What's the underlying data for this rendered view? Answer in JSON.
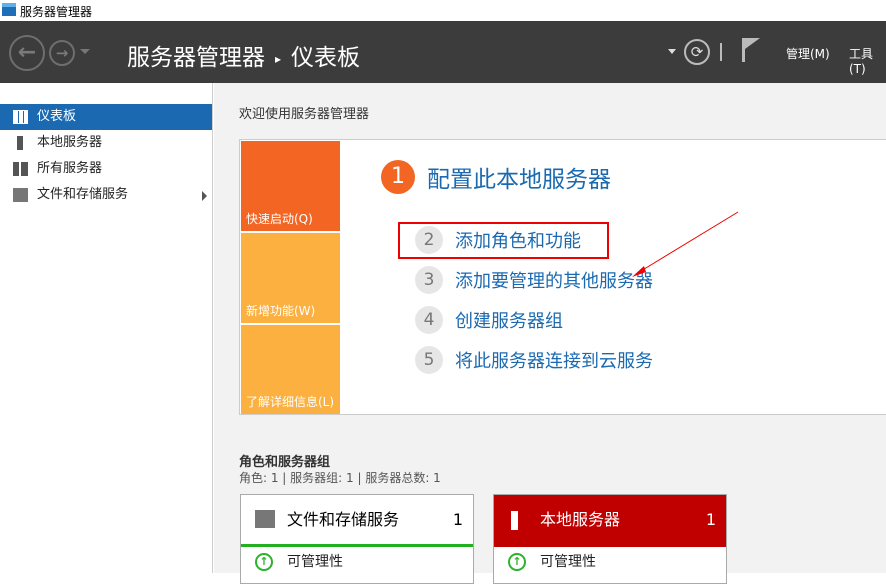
{
  "window": {
    "title": "服务器管理器"
  },
  "header": {
    "breadcrumb_root": "服务器管理器",
    "breadcrumb_sep": "▸",
    "breadcrumb_page": "仪表板",
    "menus": [
      "管理(M)",
      "工具(T)"
    ]
  },
  "sidebar": {
    "items": [
      {
        "label": "仪表板"
      },
      {
        "label": "本地服务器"
      },
      {
        "label": "所有服务器"
      },
      {
        "label": "文件和存储服务"
      }
    ]
  },
  "welcome": {
    "title": "欢迎使用服务器管理器",
    "tiles": [
      "快速启动(Q)",
      "新增功能(W)",
      "了解详细信息(L)"
    ],
    "steps": [
      {
        "num": "1",
        "label": "配置此本地服务器"
      },
      {
        "num": "2",
        "label": "添加角色和功能"
      },
      {
        "num": "3",
        "label": "添加要管理的其他服务器"
      },
      {
        "num": "4",
        "label": "创建服务器组"
      },
      {
        "num": "5",
        "label": "将此服务器连接到云服务"
      }
    ]
  },
  "roles": {
    "title": "角色和服务器组",
    "summary": "角色: 1 | 服务器组: 1 | 服务器总数: 1",
    "cards": [
      {
        "title": "文件和存储服务",
        "count": "1",
        "row": "可管理性"
      },
      {
        "title": "本地服务器",
        "count": "1",
        "row": "可管理性"
      }
    ]
  },
  "colors": {
    "accent": "#1b6ab1",
    "orange": "#f26522",
    "tile": "#fbb040",
    "local": "#c00000",
    "ok": "#2bb32b"
  }
}
